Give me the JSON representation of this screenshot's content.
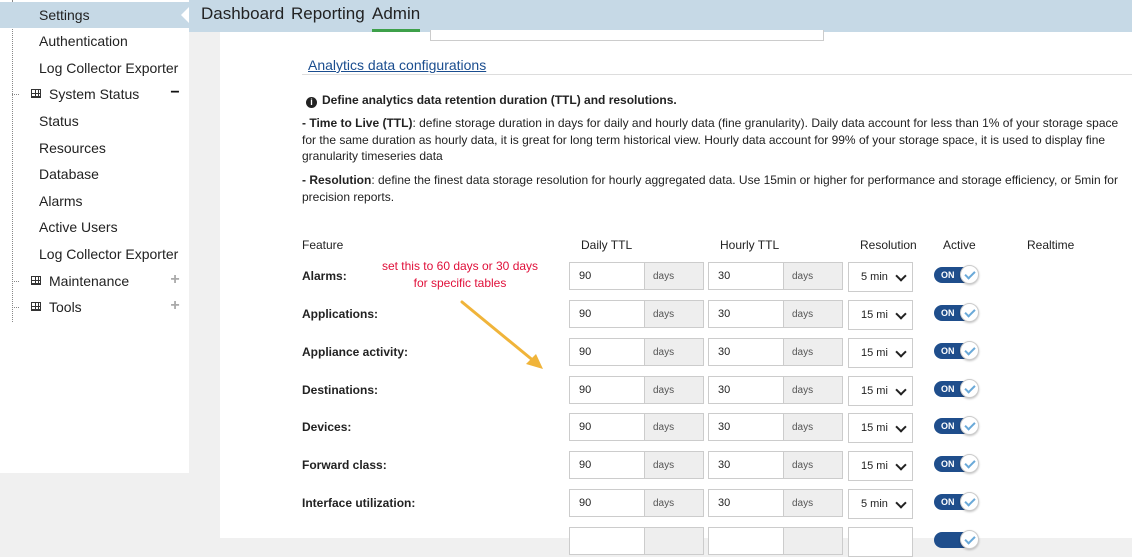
{
  "sidebar": {
    "items": [
      {
        "label": "Settings"
      },
      {
        "label": "Authentication"
      },
      {
        "label": "Log Collector Exporter"
      },
      {
        "label": "System Status"
      },
      {
        "label": "Status"
      },
      {
        "label": "Resources"
      },
      {
        "label": "Database"
      },
      {
        "label": "Alarms"
      },
      {
        "label": "Active Users"
      },
      {
        "label": "Log Collector Exporter"
      },
      {
        "label": "Maintenance"
      },
      {
        "label": "Tools"
      }
    ]
  },
  "nav": {
    "tabs": [
      {
        "label": "Dashboard"
      },
      {
        "label": "Reporting"
      },
      {
        "label": "Admin"
      }
    ],
    "active_color": "#3ea04a"
  },
  "section": {
    "link": "Analytics data configurations",
    "info": "Define analytics data retention duration (TTL) and resolutions.",
    "ttl_bold": "- Time to Live (TTL)",
    "ttl_text": ": define storage duration in days for daily and hourly data (fine granularity). Daily data account for less than 1% of your storage space for the same duration as hourly data, it is great for long term historical view. Hourly data account for 99% of your storage space, it is used to display fine granularity timeseries data",
    "res_bold": "- Resolution",
    "res_text": ": define the finest data storage resolution for hourly aggregated data. Use 15min or higher for performance and storage efficiency, or 5min for precision reports."
  },
  "table": {
    "headers": {
      "feature": "Feature",
      "daily": "Daily TTL",
      "hourly": "Hourly TTL",
      "resolution": "Resolution",
      "active": "Active",
      "realtime": "Realtime"
    },
    "unit": "days",
    "toggle_label": "ON",
    "rows": [
      {
        "feature": "Alarms:",
        "daily": "90",
        "hourly": "30",
        "resolution": "5 min"
      },
      {
        "feature": "Applications:",
        "daily": "90",
        "hourly": "30",
        "resolution": "15 mi"
      },
      {
        "feature": "Appliance activity:",
        "daily": "90",
        "hourly": "30",
        "resolution": "15 mi"
      },
      {
        "feature": "Destinations:",
        "daily": "90",
        "hourly": "30",
        "resolution": "15 mi"
      },
      {
        "feature": "Devices:",
        "daily": "90",
        "hourly": "30",
        "resolution": "15 mi"
      },
      {
        "feature": "Forward class:",
        "daily": "90",
        "hourly": "30",
        "resolution": "15 mi"
      },
      {
        "feature": "Interface utilization:",
        "daily": "90",
        "hourly": "30",
        "resolution": "5 min"
      }
    ]
  },
  "annotation": {
    "text": "set this to 60 days or 30 days for specific tables",
    "color": "#e0103a",
    "arrow_color": "#f0b43a"
  }
}
